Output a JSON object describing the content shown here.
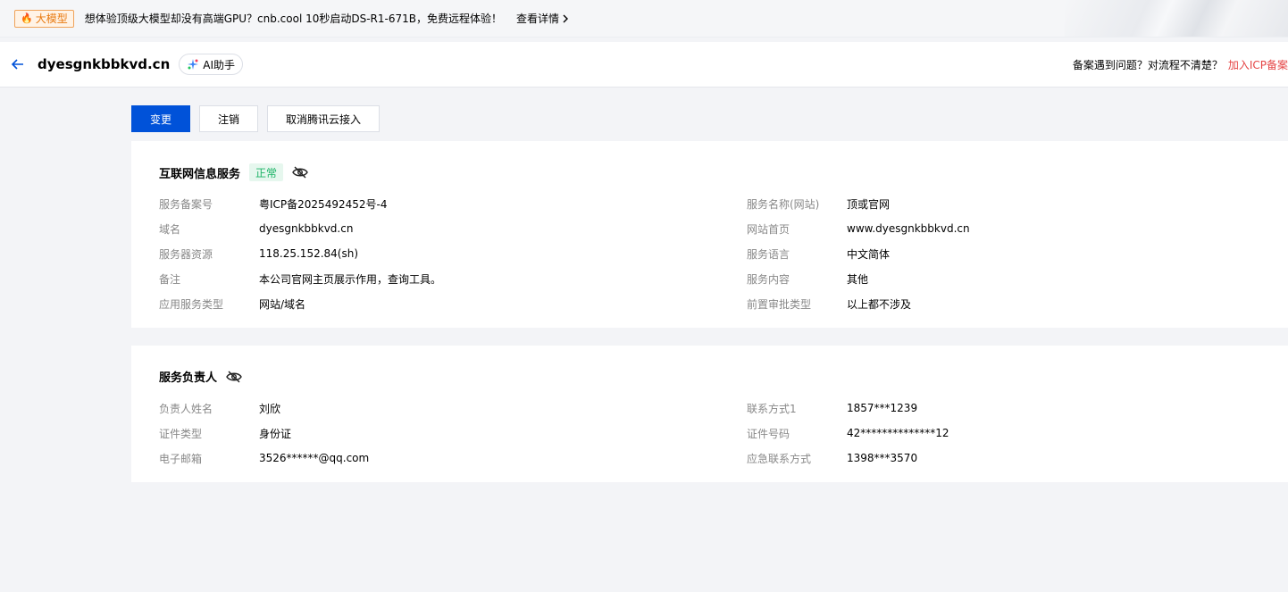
{
  "banner": {
    "badge": "大模型",
    "text": "想体验顶级大模型却没有高端GPU？cnb.cool 10秒启动DS-R1-671B，免费远程体验！",
    "link": "查看详情"
  },
  "header": {
    "domain": "dyesgnkbbkvd.cn",
    "ai_label": "AI助手",
    "help_question": "备案遇到问题？对流程不清楚？",
    "help_link": "加入ICP备案"
  },
  "actions": {
    "change": "变更",
    "cancel": "注销",
    "unlink": "取消腾讯云接入"
  },
  "service": {
    "title": "互联网信息服务",
    "status": "正常",
    "left": [
      {
        "label": "服务备案号",
        "value": "粤ICP备2025492452号-4"
      },
      {
        "label": "域名",
        "value": "dyesgnkbbkvd.cn"
      },
      {
        "label": "服务器资源",
        "value": "118.25.152.84(sh)"
      },
      {
        "label": "备注",
        "value": "本公司官网主页展示作用，查询工具。"
      },
      {
        "label": "应用服务类型",
        "value": "网站/域名"
      }
    ],
    "right": [
      {
        "label": "服务名称(网站)",
        "value": "顶或官网"
      },
      {
        "label": "网站首页",
        "value": "www.dyesgnkbbkvd.cn"
      },
      {
        "label": "服务语言",
        "value": "中文简体"
      },
      {
        "label": "服务内容",
        "value": "其他"
      },
      {
        "label": "前置审批类型",
        "value": "以上都不涉及"
      }
    ]
  },
  "owner": {
    "title": "服务负责人",
    "left": [
      {
        "label": "负责人姓名",
        "value": "刘欣"
      },
      {
        "label": "证件类型",
        "value": "身份证"
      },
      {
        "label": "电子邮箱",
        "value": "3526******@qq.com"
      }
    ],
    "right": [
      {
        "label": "联系方式1",
        "value": "1857***1239"
      },
      {
        "label": "证件号码",
        "value": "42**************12"
      },
      {
        "label": "应急联系方式",
        "value": "1398***3570"
      }
    ]
  },
  "colors": {
    "primary": "#0052d9",
    "status_green": "#1db367",
    "link_red": "#e54545",
    "badge_orange": "#e8790f"
  }
}
